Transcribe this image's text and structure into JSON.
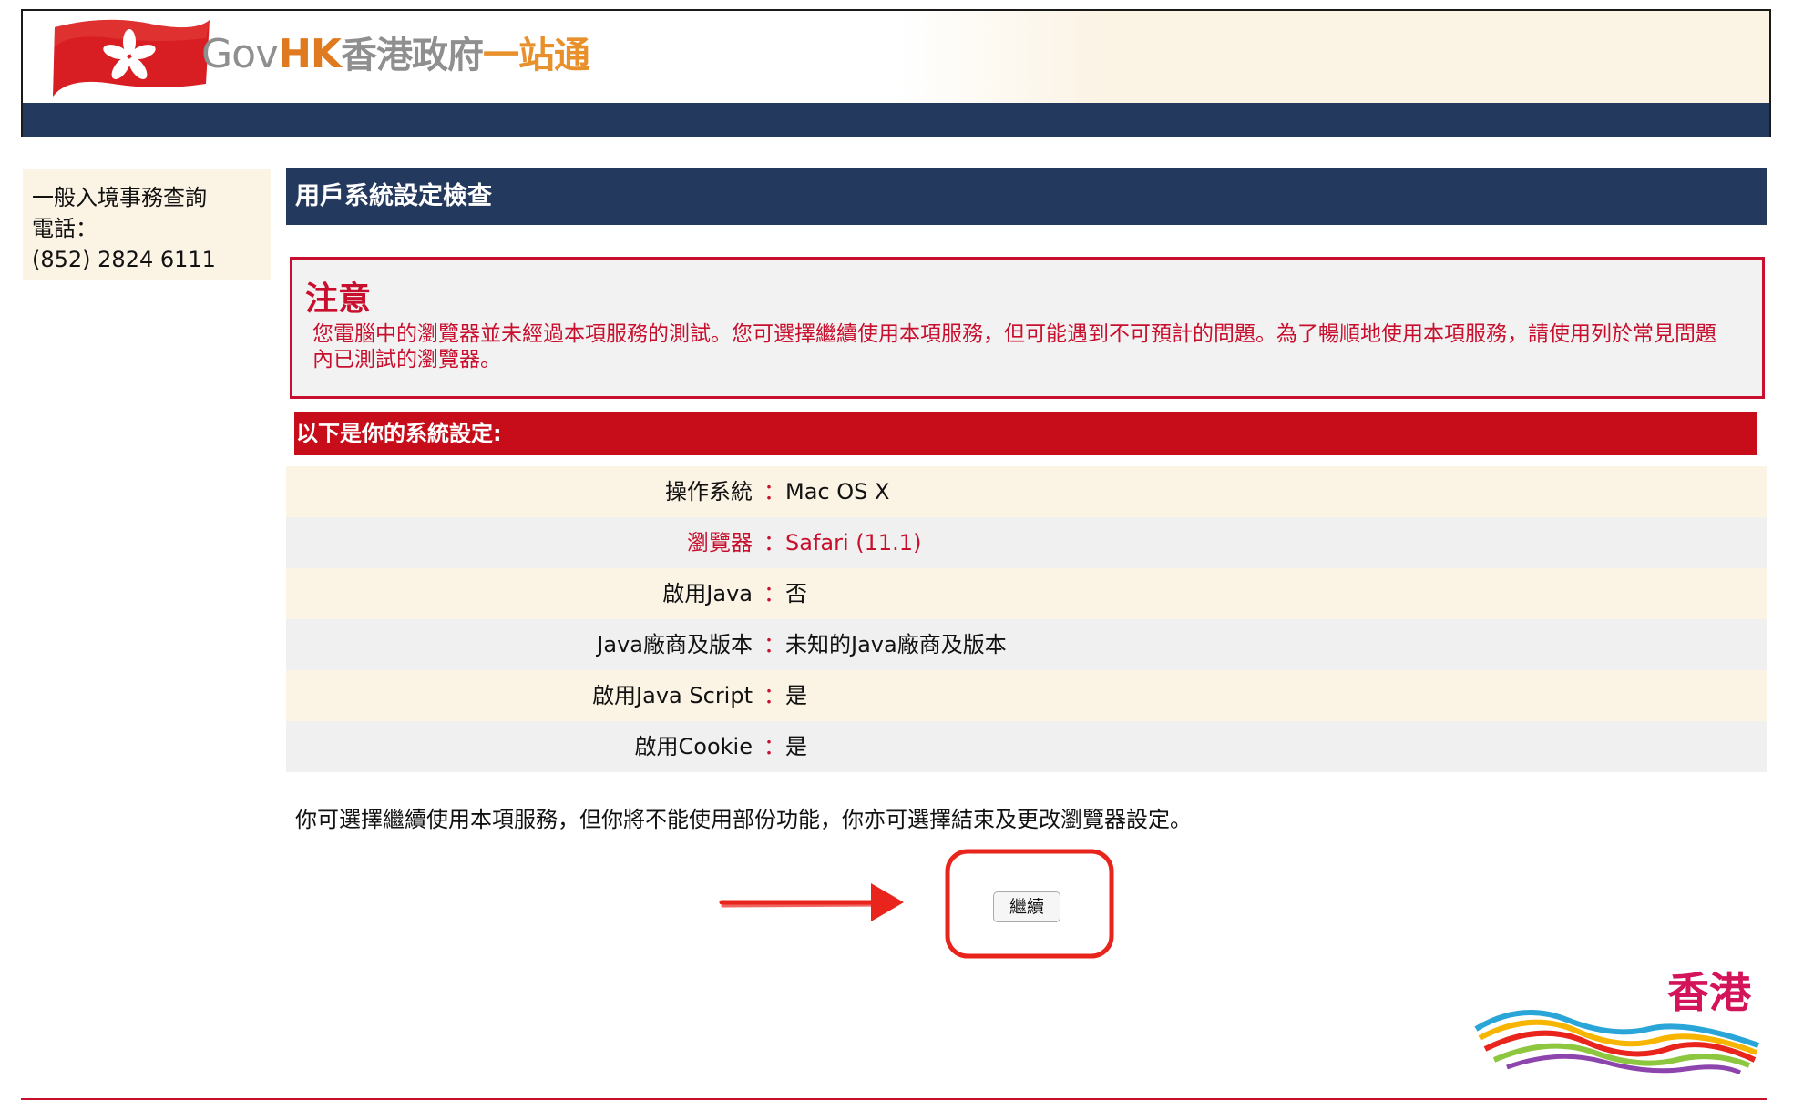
{
  "header": {
    "logo_gov": "Gov",
    "logo_hk": "HK",
    "logo_cn1": "香港政府",
    "logo_cn2": "一站通"
  },
  "sidebar": {
    "line1": "一般入境事務查詢",
    "line2": "電話：",
    "line3": "(852) 2824 6111"
  },
  "page_title": "用戶系統設定檢查",
  "notice": {
    "title": "注意",
    "text": "您電腦中的瀏覽器並未經過本項服務的測試。您可選擇繼續使用本項服務，但可能遇到不可預計的問題。為了暢順地使用本項服務，請使用列於常見問題內已測試的瀏覽器。"
  },
  "settings": {
    "header": "以下是你的系統設定:",
    "separator": "：",
    "rows": [
      {
        "label": "操作系統",
        "value": "Mac OS X"
      },
      {
        "label": "瀏覽器",
        "value": "Safari (11.1)"
      },
      {
        "label": "啟用Java",
        "value": "否"
      },
      {
        "label": "Java廠商及版本",
        "value": "未知的Java廠商及版本"
      },
      {
        "label": "啟用Java Script",
        "value": "是"
      },
      {
        "label": "啟用Cookie",
        "value": "是"
      }
    ]
  },
  "info_text": "你可選擇繼續使用本項服務，但你將不能使用部份功能，你亦可選擇結束及更改瀏覽器設定。",
  "continue_button": "繼續",
  "brand_hk_text": "香港",
  "colors": {
    "navy": "#24395e",
    "red": "#c8102e",
    "cream": "#fbf3e4"
  }
}
